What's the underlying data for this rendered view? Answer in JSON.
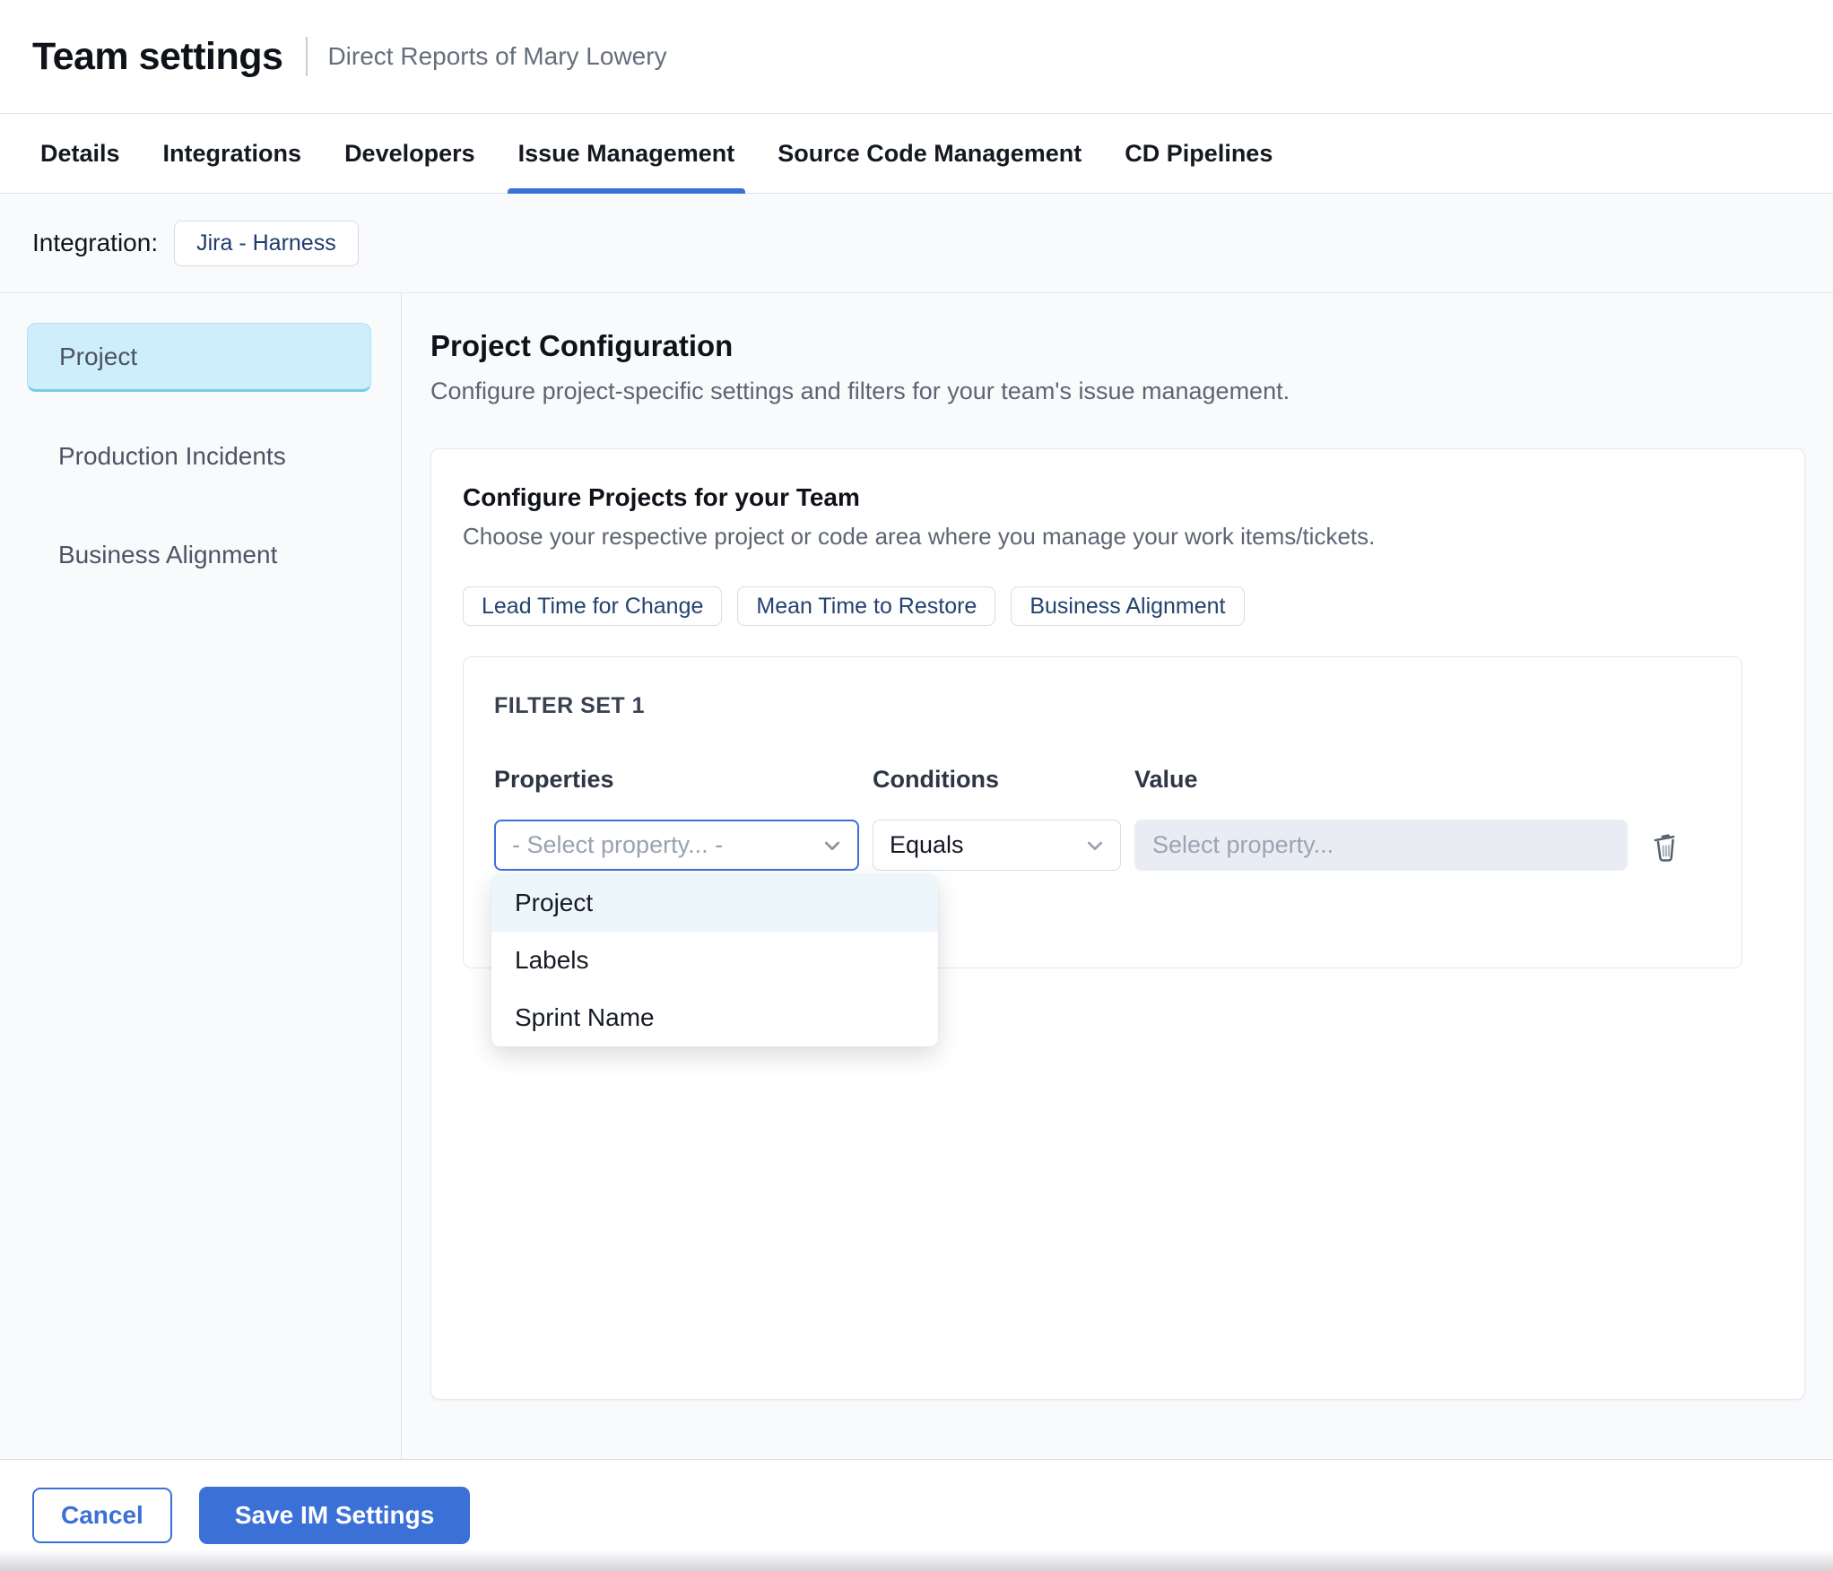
{
  "header": {
    "title": "Team settings",
    "subtitle": "Direct Reports of Mary Lowery"
  },
  "tabs": [
    {
      "label": "Details",
      "active": false
    },
    {
      "label": "Integrations",
      "active": false
    },
    {
      "label": "Developers",
      "active": false
    },
    {
      "label": "Issue Management",
      "active": true
    },
    {
      "label": "Source Code Management",
      "active": false
    },
    {
      "label": "CD Pipelines",
      "active": false
    }
  ],
  "integration": {
    "label": "Integration:",
    "value": "Jira - Harness"
  },
  "sidebar": {
    "items": [
      {
        "label": "Project",
        "active": true
      },
      {
        "label": "Production Incidents",
        "active": false
      },
      {
        "label": "Business Alignment",
        "active": false
      }
    ]
  },
  "main": {
    "title": "Project Configuration",
    "description": "Configure project-specific settings and filters for your team's issue management.",
    "card": {
      "title": "Configure Projects for your Team",
      "description": "Choose your respective project or code area where you manage your work items/tickets.",
      "metric_chips": [
        "Lead Time for Change",
        "Mean Time to Restore",
        "Business Alignment"
      ],
      "filter_set": {
        "title": "FILTER SET 1",
        "properties_label": "Properties",
        "conditions_label": "Conditions",
        "value_label": "Value",
        "property_placeholder": "- Select property... -",
        "condition_selected": "Equals",
        "value_placeholder": "Select property...",
        "property_options": [
          {
            "label": "Project",
            "highlighted": true
          },
          {
            "label": "Labels",
            "highlighted": false
          },
          {
            "label": "Sprint Name",
            "highlighted": false
          }
        ]
      }
    }
  },
  "footer": {
    "cancel_label": "Cancel",
    "save_label": "Save IM Settings"
  },
  "icons": {
    "chevron": "chevron-down-icon",
    "delete": "trash-icon"
  },
  "colors": {
    "accent_blue": "#3b70d6",
    "active_tab_underline": "#3b70d6",
    "sidebar_active_bg": "#cdeefa",
    "sidebar_active_border": "#76cce8",
    "dropdown_highlight_bg": "#edf6fb",
    "chip_text": "#24436e",
    "disabled_input_bg": "#e9edf3",
    "page_bg": "#f9fafc"
  }
}
